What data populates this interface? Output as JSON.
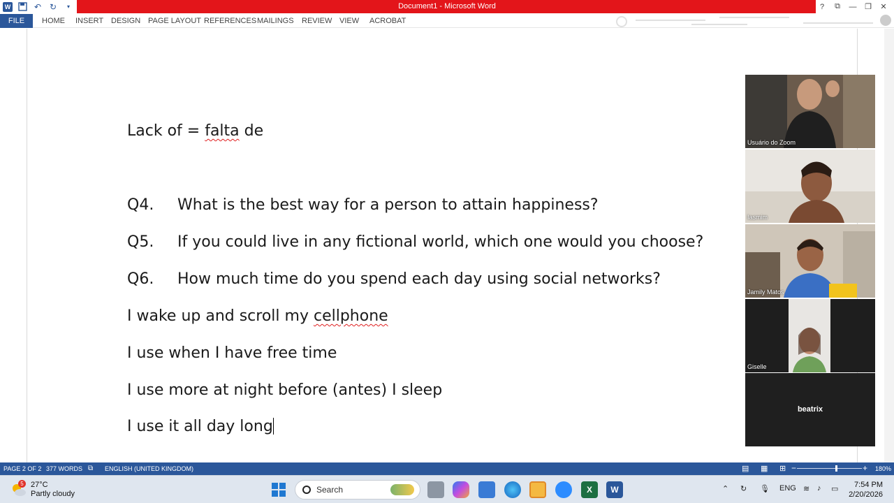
{
  "window": {
    "title": "Document1 - Microsoft Word",
    "controls": {
      "help": "?",
      "ribbon_display": "⧉",
      "minimize": "—",
      "restore": "❐",
      "close": "✕"
    }
  },
  "ribbon": {
    "tabs": [
      "FILE",
      "HOME",
      "INSERT",
      "DESIGN",
      "PAGE LAYOUT",
      "REFERENCES",
      "MAILINGS",
      "REVIEW",
      "VIEW",
      "ACROBAT"
    ]
  },
  "document": {
    "line1": {
      "before": "Lack of = ",
      "misspelled": "falta",
      "after": " de"
    },
    "questions": [
      {
        "num": "Q4.",
        "text": "What is the best way for a person to attain happiness?"
      },
      {
        "num": "Q5.",
        "text": "If you could live in any fictional world, which one would you choose?"
      },
      {
        "num": "Q6.",
        "text": "How much time do you spend each day using social networks?"
      }
    ],
    "answer1": {
      "before": "I wake up and scroll my ",
      "misspelled": "cellphone"
    },
    "answer2": "I use when I have free time",
    "answer3": "I use more at night before (antes) I sleep",
    "answer4": "I use it all day long"
  },
  "participants": [
    {
      "name": "Usuário do Zoom",
      "video": true
    },
    {
      "name": "Iasmim",
      "video": true
    },
    {
      "name": "Jamily Matos",
      "video": true
    },
    {
      "name": "Giselle",
      "video": true
    },
    {
      "name": "beatrix",
      "video": false
    }
  ],
  "statusbar": {
    "page": "PAGE 2 OF 2",
    "words": "377 WORDS",
    "language": "ENGLISH (UNITED KINGDOM)",
    "zoom": "180%",
    "zoom_fraction": 0.6
  },
  "taskbar": {
    "weather_temp": "27°C",
    "weather_desc": "Partly cloudy",
    "weather_badge": "5",
    "search_placeholder": "Search",
    "lang": "ENG",
    "time": "7:54 PM",
    "date": "2/20/2026"
  },
  "colors": {
    "word_blue": "#2b579a",
    "title_red": "#e3151a"
  }
}
